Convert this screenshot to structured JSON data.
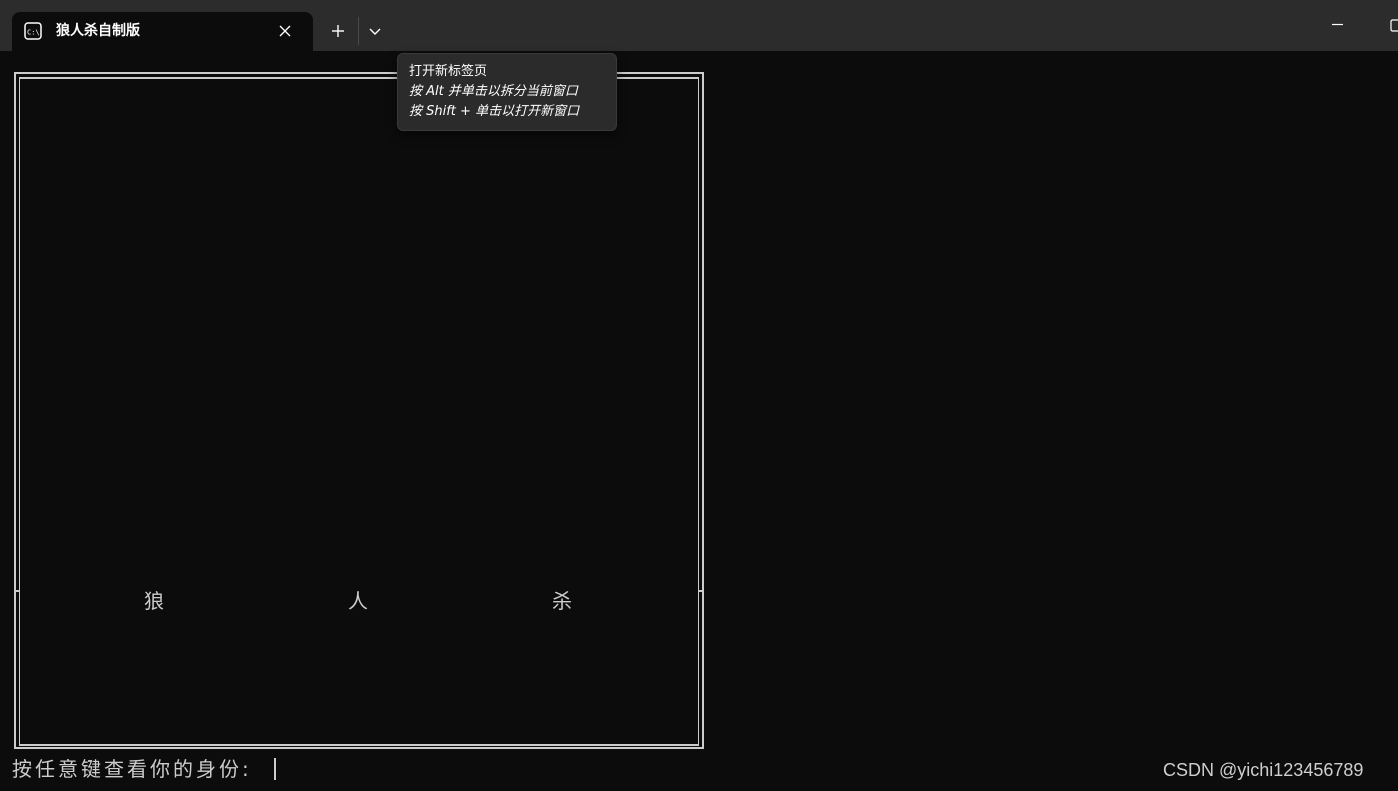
{
  "tab": {
    "title": "狼人杀自制版",
    "icon": "terminal-icon"
  },
  "tooltip": {
    "line1": "打开新标签页",
    "line2": "按 Alt 并单击以拆分当前窗口",
    "line3": "按 Shift + 单击以打开新窗口"
  },
  "game": {
    "title_chars": [
      "狼",
      "人",
      "杀"
    ]
  },
  "prompt": {
    "text": "按任意键查看你的身份:"
  },
  "watermark": {
    "text": "CSDN @yichi123456789"
  },
  "colors": {
    "terminal_bg": "#0c0c0c",
    "titlebar_bg": "#2c2c2c",
    "text": "#cccccc",
    "tooltip_bg": "#2b2b2b"
  }
}
